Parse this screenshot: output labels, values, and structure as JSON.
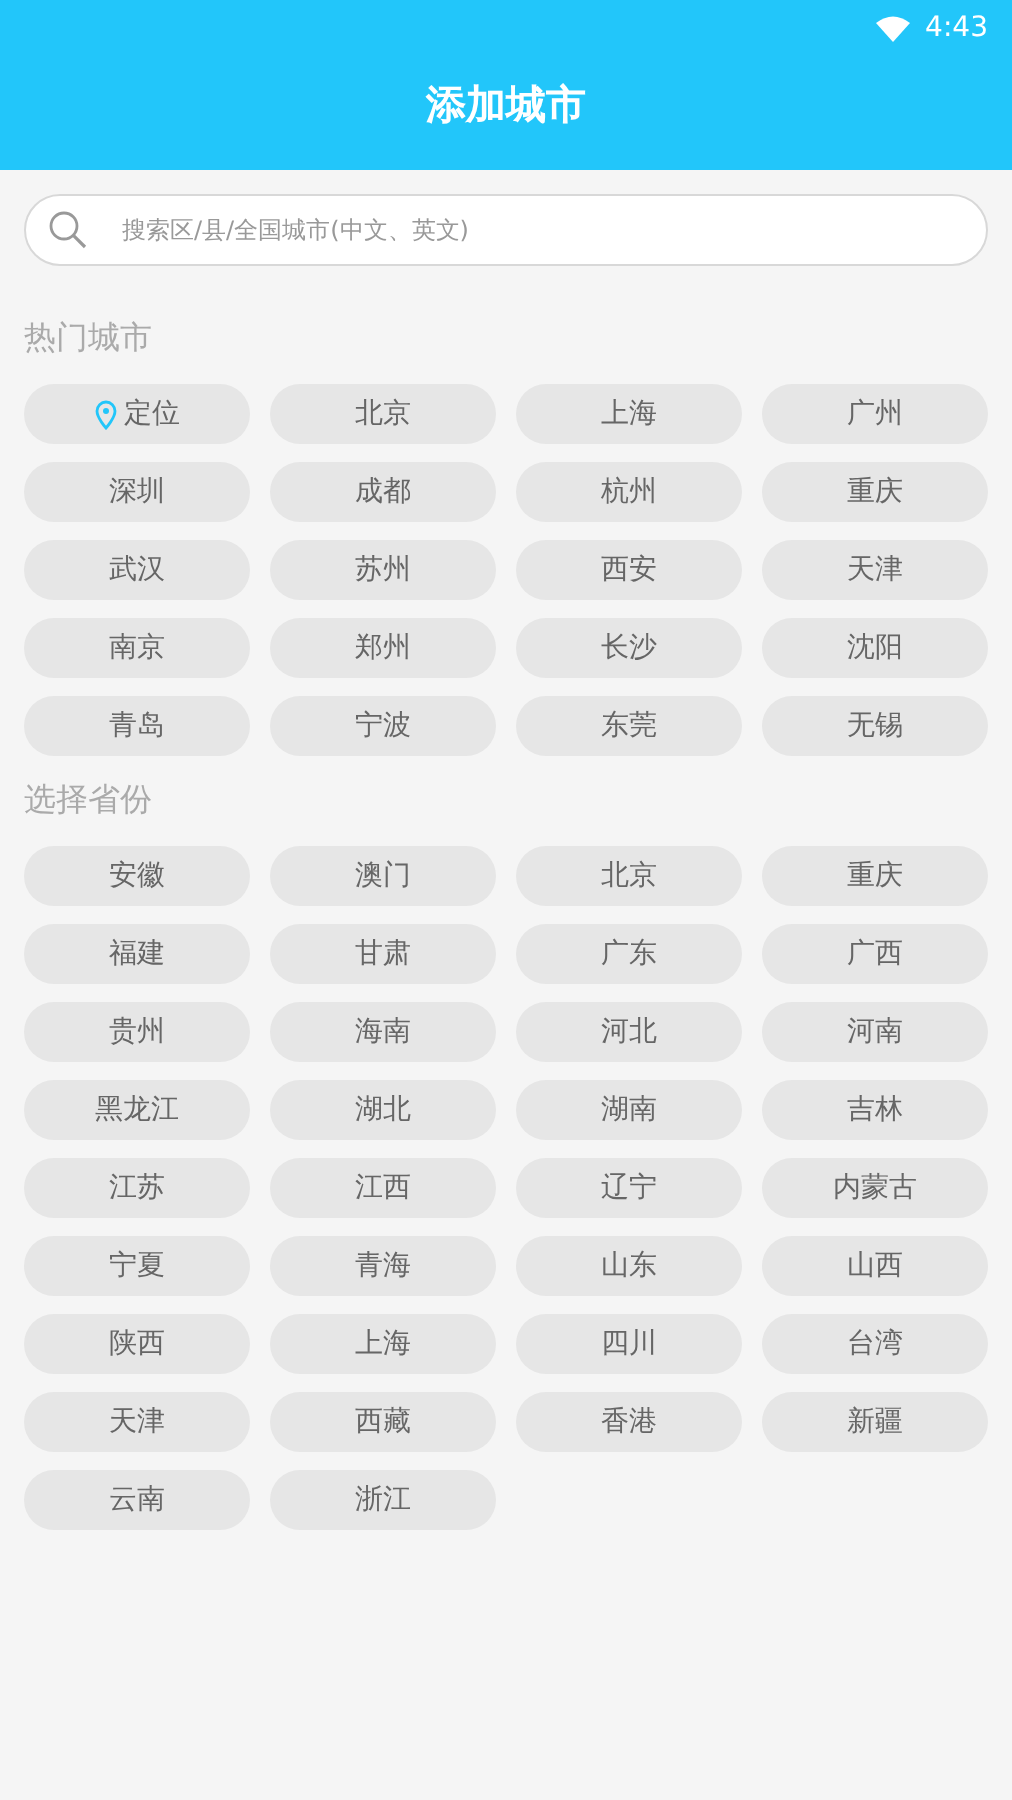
{
  "status_bar": {
    "time": "4:43"
  },
  "header": {
    "title": "添加城市"
  },
  "search": {
    "placeholder": "搜索区/县/全国城市(中文、英文)"
  },
  "sections": [
    {
      "title": "热门城市",
      "items": [
        {
          "label": "定位",
          "kind": "location"
        },
        {
          "label": "北京",
          "kind": "city"
        },
        {
          "label": "上海",
          "kind": "city"
        },
        {
          "label": "广州",
          "kind": "city"
        },
        {
          "label": "深圳",
          "kind": "city"
        },
        {
          "label": "成都",
          "kind": "city"
        },
        {
          "label": "杭州",
          "kind": "city"
        },
        {
          "label": "重庆",
          "kind": "city"
        },
        {
          "label": "武汉",
          "kind": "city"
        },
        {
          "label": "苏州",
          "kind": "city"
        },
        {
          "label": "西安",
          "kind": "city"
        },
        {
          "label": "天津",
          "kind": "city"
        },
        {
          "label": "南京",
          "kind": "city"
        },
        {
          "label": "郑州",
          "kind": "city"
        },
        {
          "label": "长沙",
          "kind": "city"
        },
        {
          "label": "沈阳",
          "kind": "city"
        },
        {
          "label": "青岛",
          "kind": "city"
        },
        {
          "label": "宁波",
          "kind": "city"
        },
        {
          "label": "东莞",
          "kind": "city"
        },
        {
          "label": "无锡",
          "kind": "city"
        }
      ]
    },
    {
      "title": "选择省份",
      "items": [
        {
          "label": "安徽",
          "kind": "city"
        },
        {
          "label": "澳门",
          "kind": "city"
        },
        {
          "label": "北京",
          "kind": "city"
        },
        {
          "label": "重庆",
          "kind": "city"
        },
        {
          "label": "福建",
          "kind": "city"
        },
        {
          "label": "甘肃",
          "kind": "city"
        },
        {
          "label": "广东",
          "kind": "city"
        },
        {
          "label": "广西",
          "kind": "city"
        },
        {
          "label": "贵州",
          "kind": "city"
        },
        {
          "label": "海南",
          "kind": "city"
        },
        {
          "label": "河北",
          "kind": "city"
        },
        {
          "label": "河南",
          "kind": "city"
        },
        {
          "label": "黑龙江",
          "kind": "city"
        },
        {
          "label": "湖北",
          "kind": "city"
        },
        {
          "label": "湖南",
          "kind": "city"
        },
        {
          "label": "吉林",
          "kind": "city"
        },
        {
          "label": "江苏",
          "kind": "city"
        },
        {
          "label": "江西",
          "kind": "city"
        },
        {
          "label": "辽宁",
          "kind": "city"
        },
        {
          "label": "内蒙古",
          "kind": "city"
        },
        {
          "label": "宁夏",
          "kind": "city"
        },
        {
          "label": "青海",
          "kind": "city"
        },
        {
          "label": "山东",
          "kind": "city"
        },
        {
          "label": "山西",
          "kind": "city"
        },
        {
          "label": "陕西",
          "kind": "city"
        },
        {
          "label": "上海",
          "kind": "city"
        },
        {
          "label": "四川",
          "kind": "city"
        },
        {
          "label": "台湾",
          "kind": "city"
        },
        {
          "label": "天津",
          "kind": "city"
        },
        {
          "label": "西藏",
          "kind": "city"
        },
        {
          "label": "香港",
          "kind": "city"
        },
        {
          "label": "新疆",
          "kind": "city"
        },
        {
          "label": "云南",
          "kind": "city"
        },
        {
          "label": "浙江",
          "kind": "city"
        }
      ]
    }
  ]
}
